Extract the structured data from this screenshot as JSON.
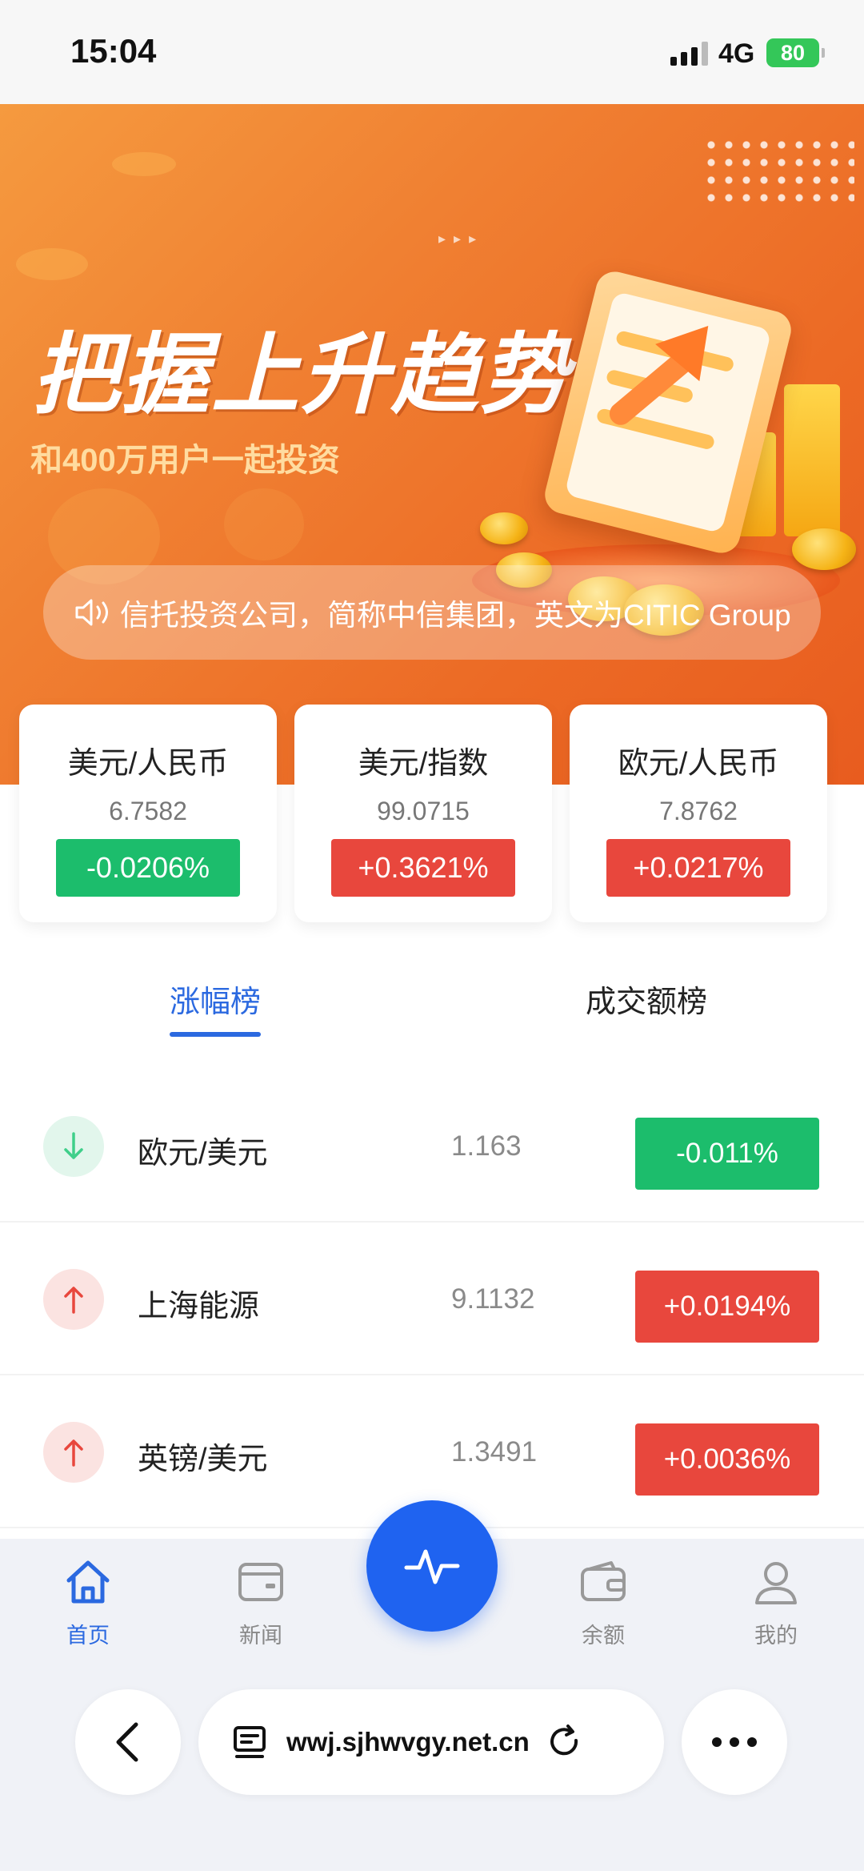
{
  "status_bar": {
    "time": "15:04",
    "network": "4G",
    "battery": "80"
  },
  "banner": {
    "title": "把握上升趋势",
    "subtitle": "和400万用户一起投资",
    "notice": "信托投资公司，简称中信集团，英文为CITIC Group"
  },
  "cards": [
    {
      "name": "美元/人民币",
      "value": "6.7582",
      "change": "-0.0206%",
      "trend": "down"
    },
    {
      "name": "美元/指数",
      "value": "99.0715",
      "change": "+0.3621%",
      "trend": "up"
    },
    {
      "name": "欧元/人民币",
      "value": "7.8762",
      "change": "+0.0217%",
      "trend": "up"
    }
  ],
  "tabs": {
    "active": "涨幅榜",
    "other": "成交额榜"
  },
  "rows": [
    {
      "name": "欧元/美元",
      "price": "1.163",
      "change": "-0.011%",
      "trend": "down"
    },
    {
      "name": "上海能源",
      "price": "9.1132",
      "change": "+0.0194%",
      "trend": "up"
    },
    {
      "name": "英镑/美元",
      "price": "1.3491",
      "change": "+0.0036%",
      "trend": "up"
    }
  ],
  "tabbar": {
    "home": "首页",
    "news": "新闻",
    "balance": "余额",
    "mine": "我的"
  },
  "browser": {
    "url": "wwj.sjhwvgy.net.cn"
  },
  "colors": {
    "accent": "#2b69e0",
    "up": "#e8473d",
    "down": "#1cbd6c",
    "banner": "#ec6a25"
  }
}
